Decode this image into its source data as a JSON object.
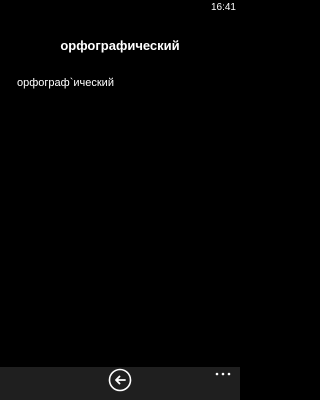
{
  "status_bar": {
    "time": "16:41"
  },
  "page": {
    "title": "орфографический",
    "stressed_word": "орфограф`ический"
  },
  "app_bar": {
    "back_icon": "back-arrow-circle-icon",
    "more_icon": "ellipsis-icon"
  },
  "colors": {
    "background": "#000000",
    "app_bar": "#1f1f1f",
    "text": "#ffffff"
  }
}
